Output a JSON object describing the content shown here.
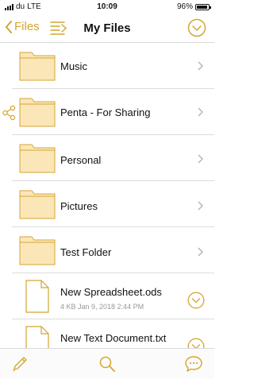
{
  "status_bar": {
    "carrier": "du",
    "network": "LTE",
    "time": "10:09",
    "battery": "96%",
    "battery_level": 0.96
  },
  "nav": {
    "back_label": "Files",
    "title": "My Files"
  },
  "items": [
    {
      "name": "Music",
      "type": "folder"
    },
    {
      "name": "Penta - For Sharing",
      "type": "folder",
      "shared": true
    },
    {
      "name": "Personal",
      "type": "folder"
    },
    {
      "name": "Pictures",
      "type": "folder"
    },
    {
      "name": "Test Folder",
      "type": "folder"
    },
    {
      "name": "New Spreadsheet.ods",
      "type": "file",
      "meta": "4 KB  Jan 9, 2018 2:44 PM"
    },
    {
      "name": "New Text Document.txt",
      "type": "file"
    }
  ],
  "tab_bar": {
    "icons": [
      "pencil-icon",
      "search-icon",
      "chat-bubble-icon"
    ]
  },
  "colors": {
    "accent": "#d4a532",
    "folder_fill": "#fbe6b8",
    "folder_stroke": "#d4a532",
    "divider": "#dcdcdc"
  }
}
